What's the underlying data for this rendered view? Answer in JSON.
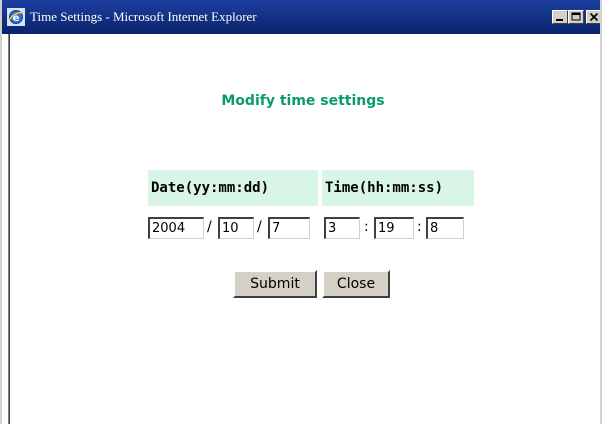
{
  "window": {
    "title": "Time Settings - Microsoft Internet Explorer",
    "icon": "ie-icon",
    "controls": [
      "minimize-icon",
      "maximize-icon",
      "close-icon"
    ],
    "titlebar_color": "#0a246a"
  },
  "form": {
    "heading": "Modify time settings",
    "heading_color": "#0a9c68",
    "header_bg": "#d8f5e6",
    "date_header": "Date(yy:mm:dd)",
    "time_header": "Time(hh:mm:ss)",
    "date": {
      "year": "2004",
      "month": "10",
      "day": "7",
      "separator": "/"
    },
    "time": {
      "hour": "3",
      "minute": "19",
      "second": "8",
      "separator": ":"
    },
    "submit_label": "Submit",
    "close_label": "Close"
  }
}
